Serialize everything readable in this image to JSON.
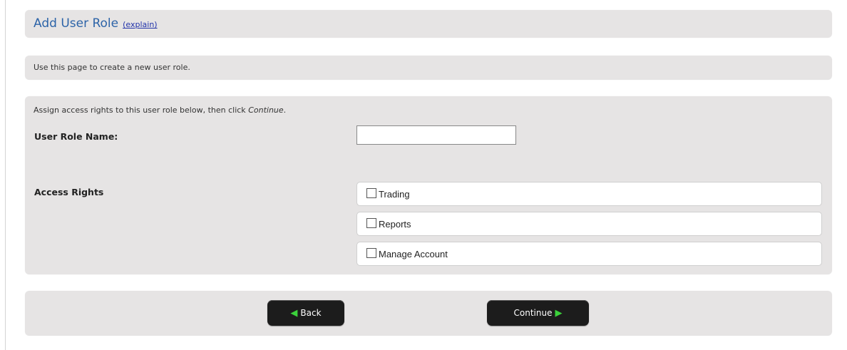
{
  "header": {
    "title": "Add User Role",
    "explain_link": "(explain)"
  },
  "intro": {
    "text": "Use this page to create a new user role."
  },
  "form": {
    "instructions_prefix": "Assign access rights to this user role below, then click ",
    "instructions_emphasis": "Continue",
    "instructions_suffix": ".",
    "role_name_label": "User Role Name:",
    "role_name_value": "",
    "access_rights_label": "Access Rights",
    "access_rights": [
      {
        "label": "Trading",
        "checked": false
      },
      {
        "label": "Reports",
        "checked": false
      },
      {
        "label": "Manage Account",
        "checked": false
      }
    ]
  },
  "buttons": {
    "back_label": "Back",
    "continue_label": "Continue",
    "arrow_color": "#3bd13b"
  },
  "colors": {
    "panel_bg": "#e6e4e4",
    "title_color": "#2d64a8",
    "link_color": "#2233aa",
    "button_bg": "#1c1c1c"
  },
  "icons": {
    "back_arrow": "left-arrow-icon",
    "continue_arrow": "right-arrow-icon"
  }
}
